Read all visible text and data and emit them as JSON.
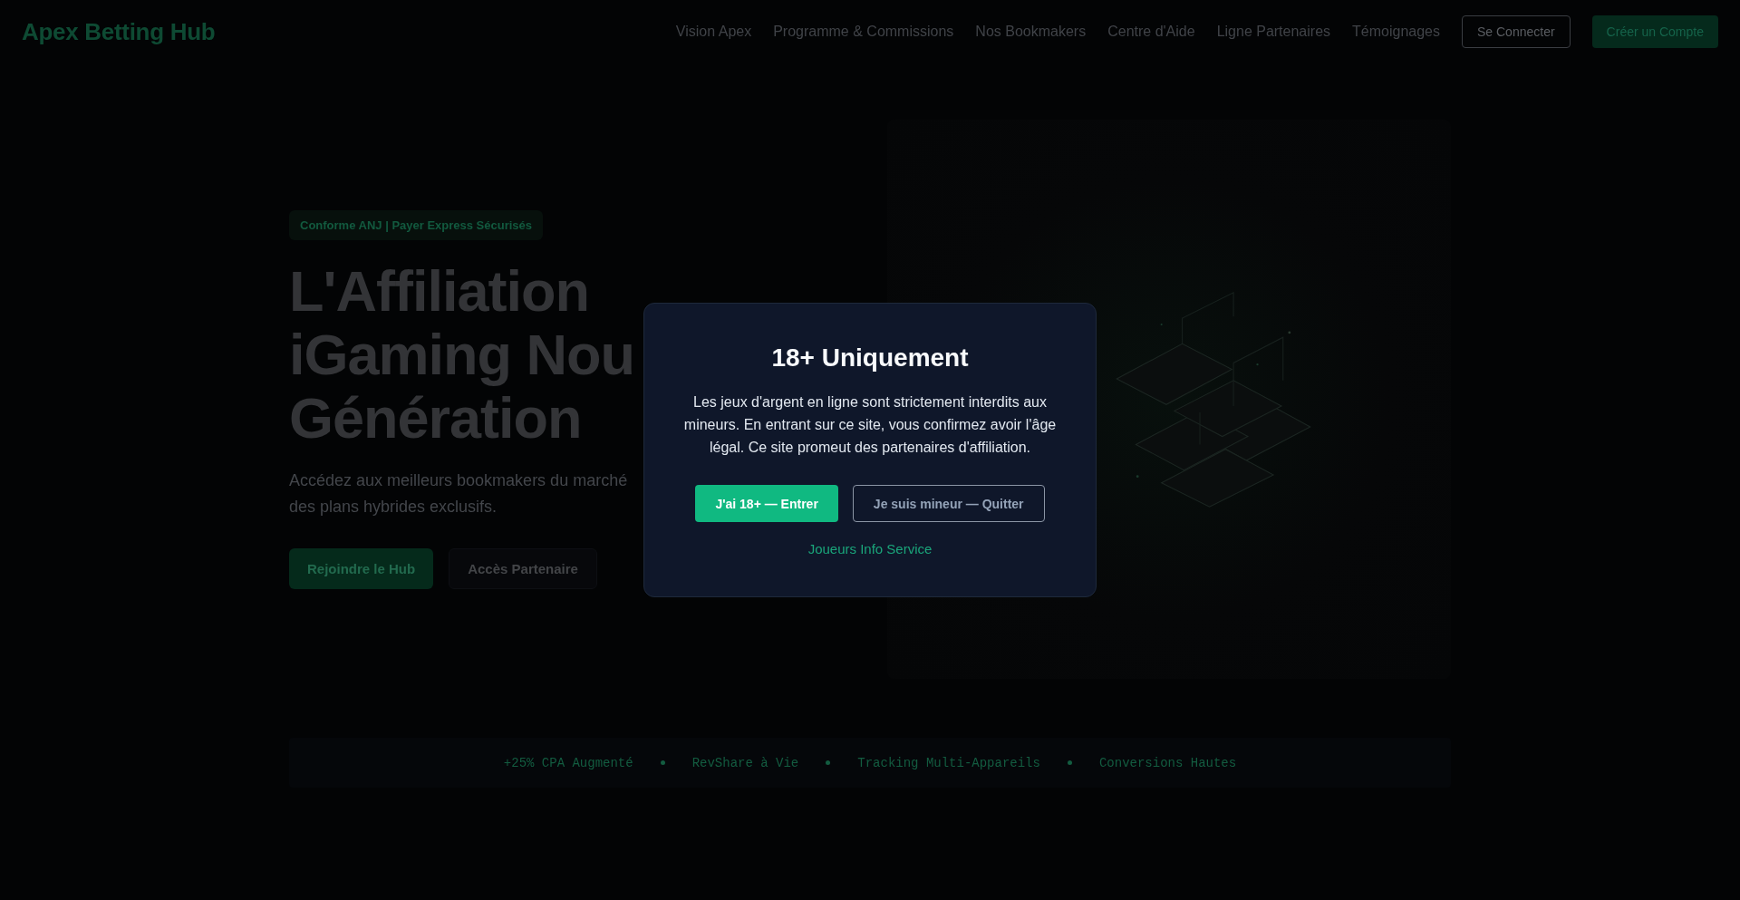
{
  "nav": {
    "logo": "Apex Betting Hub",
    "links": [
      "Vision Apex",
      "Programme & Commissions",
      "Nos Bookmakers",
      "Centre d'Aide",
      "Ligne Partenaires",
      "Témoignages"
    ],
    "login_button": "Se Connecter",
    "signup_button": "Créer un Compte"
  },
  "hero": {
    "badge": "Conforme ANJ | Payer Express Sécurisés",
    "title_lines": [
      "L'Affiliation",
      "iGaming Nou",
      "Génération"
    ],
    "subtitle_lines": [
      "Accédez aux meilleurs bookmakers du marché",
      "des plans hybrides exclusifs."
    ],
    "buttons": [
      {
        "label": "Rejoindre le Hub",
        "kind": "primary"
      },
      {
        "label": "Accès Partenaire",
        "kind": "secondary"
      }
    ]
  },
  "features": [
    "+25% CPA Augmenté",
    "RevShare à Vie",
    "Tracking Multi-Appareils",
    "Conversions Hautes"
  ],
  "age_modal": {
    "title": "18+ Uniquement",
    "message": "Les jeux d'argent en ligne sont strictement interdits aux mineurs. En entrant sur ce site, vous confirmez avoir l'âge légal. Ce site promeut des partenaires d'affiliation.",
    "buttons": [
      {
        "label": "J'ai 18+ — Entrer",
        "kind": "primary"
      },
      {
        "label": "Je suis mineur — Quitter",
        "kind": "secondary"
      }
    ],
    "link": "Joueurs Info Service"
  }
}
